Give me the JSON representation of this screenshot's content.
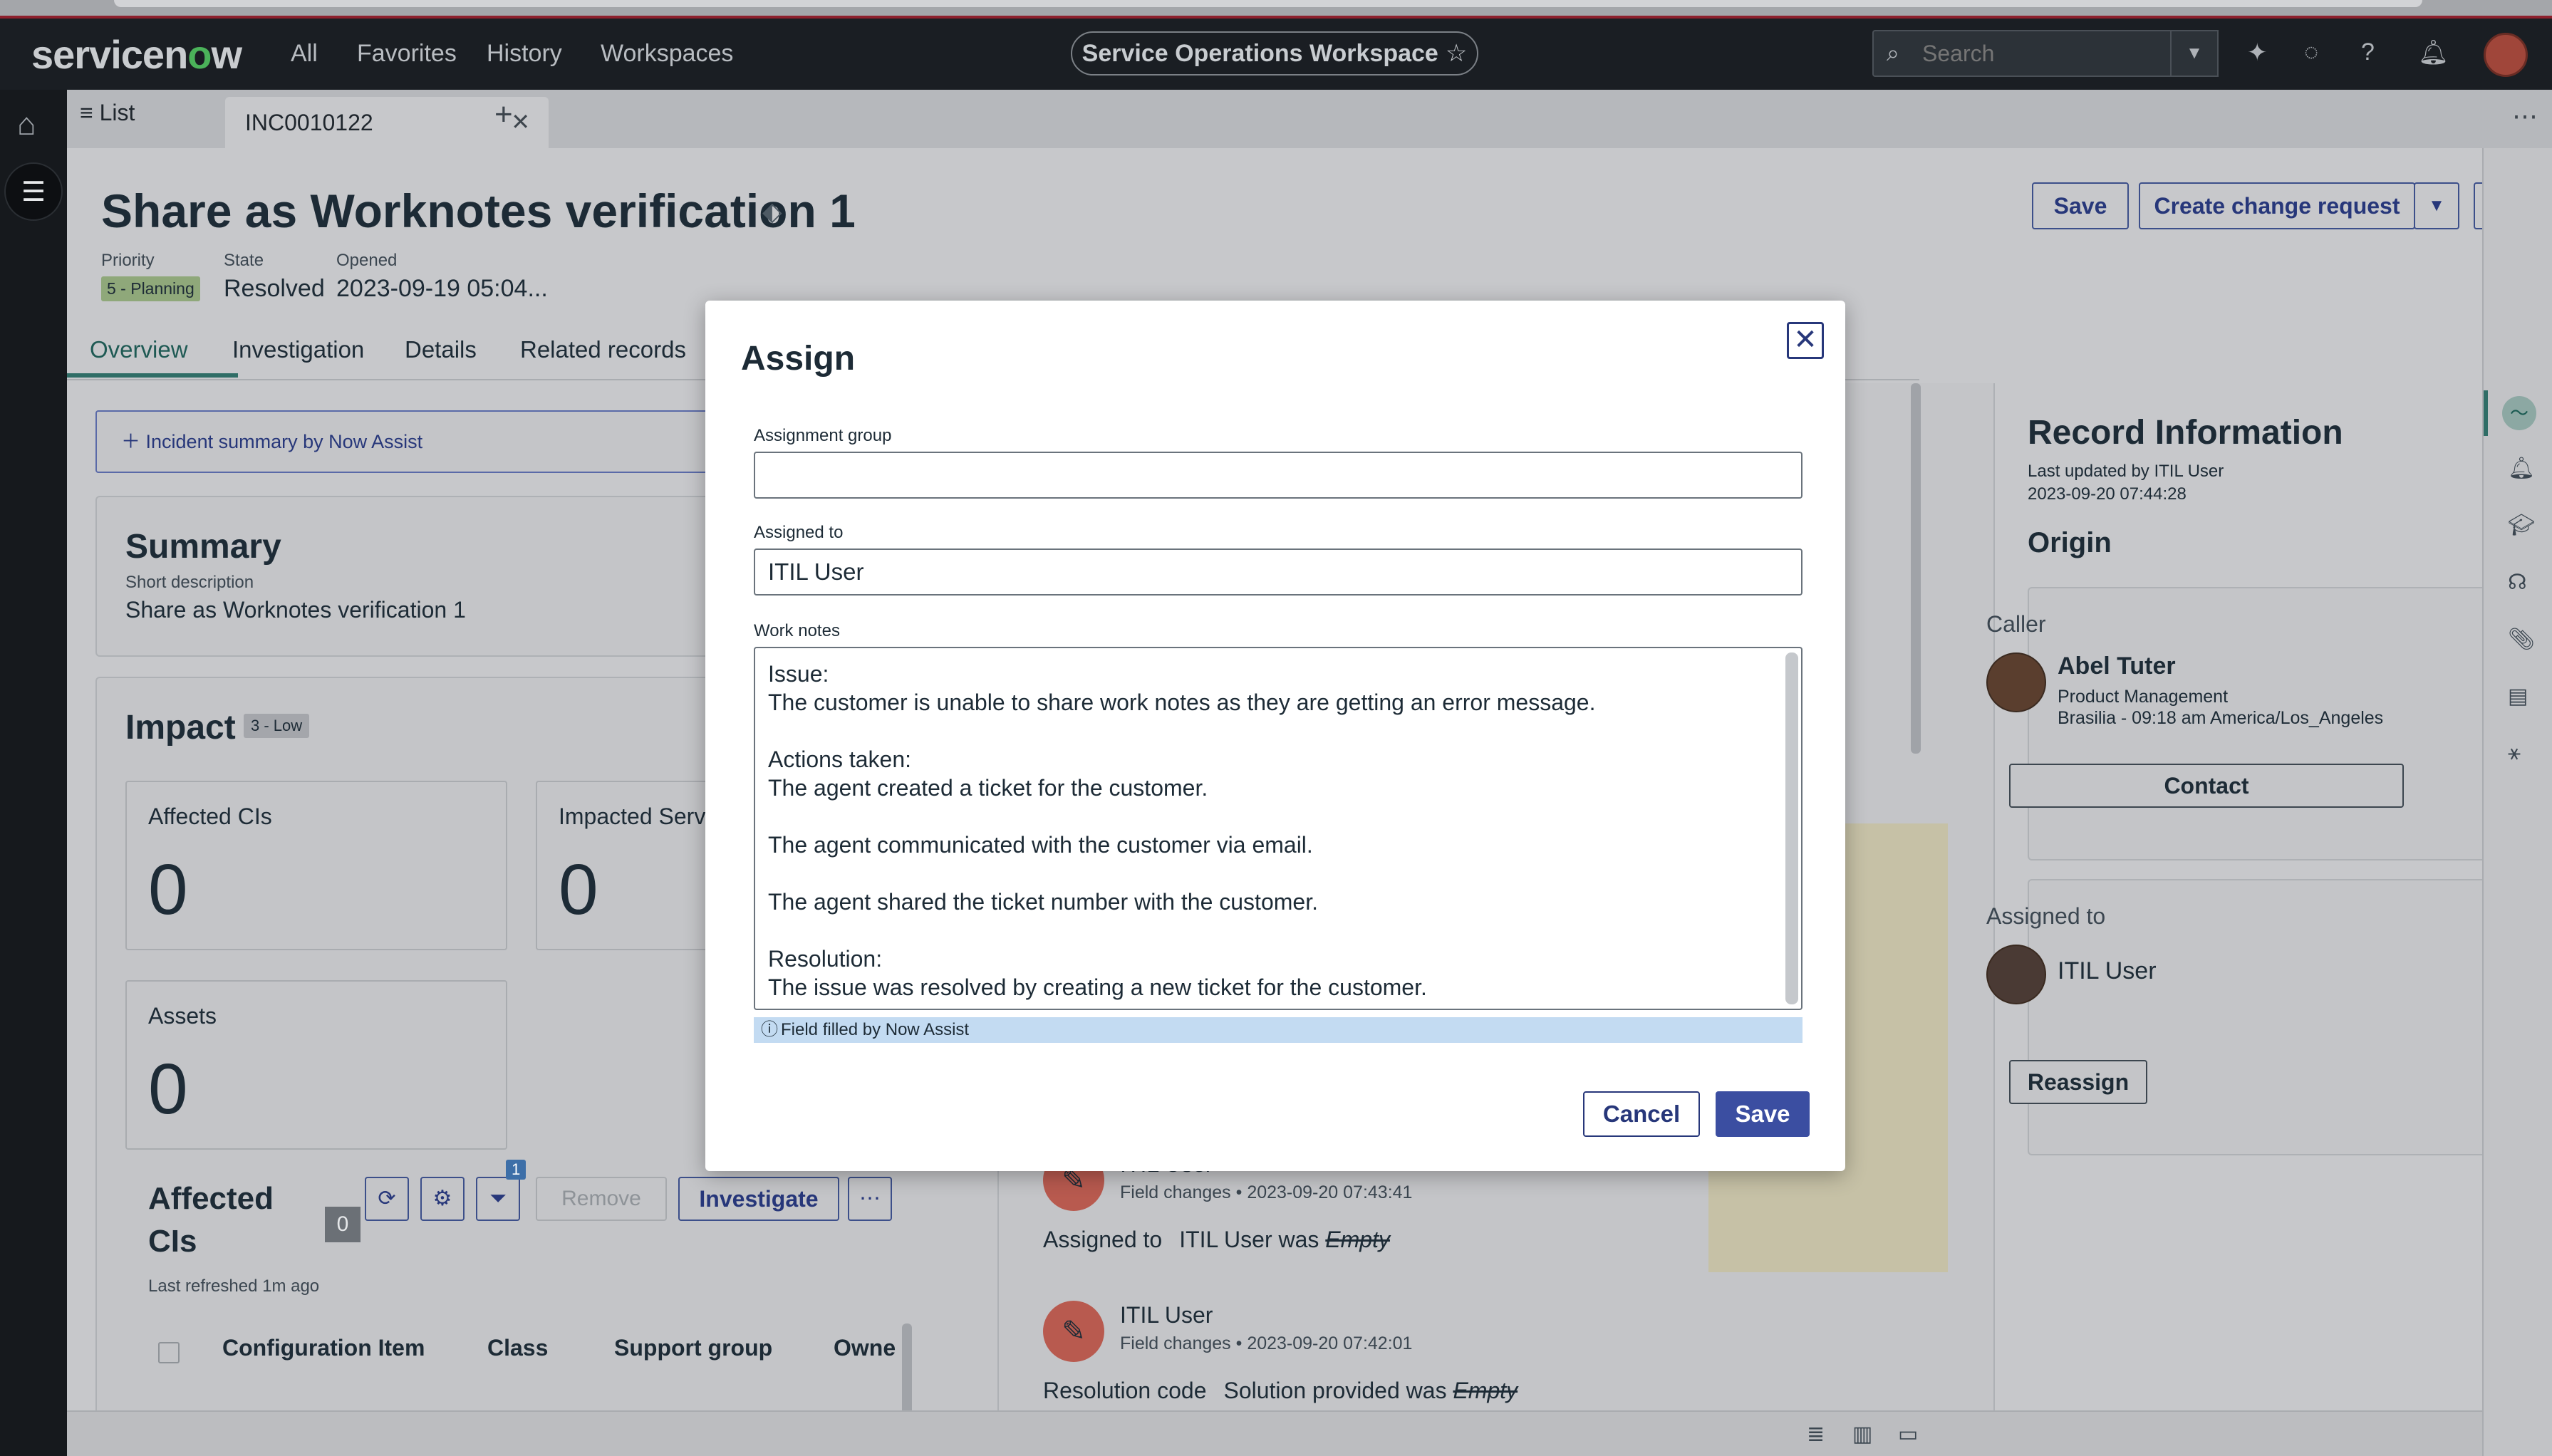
{
  "header": {
    "logo": "servicenow",
    "nav": [
      "All",
      "Favorites",
      "History",
      "Workspaces"
    ],
    "workspace": "Service Operations Workspace",
    "search_placeholder": "Search"
  },
  "tabs": {
    "list_label": "List",
    "active_tab": "INC0010122"
  },
  "record": {
    "title": "Share as Worknotes verification 1",
    "priority_label": "Priority",
    "priority_value": "5 - Planning",
    "state_label": "State",
    "state_value": "Resolved",
    "opened_label": "Opened",
    "opened_value": "2023-09-19 05:04...",
    "save_label": "Save",
    "create_change_label": "Create change request"
  },
  "page_tabs": [
    "Overview",
    "Investigation",
    "Details",
    "Related records"
  ],
  "overview": {
    "now_assist_label": "Incident summary by Now Assist",
    "summary_title": "Summary",
    "short_desc_label": "Short description",
    "short_desc_value": "Share as Worknotes verification 1",
    "impact_title": "Impact",
    "impact_badge": "3 - Low",
    "metrics": [
      {
        "label": "Affected CIs",
        "value": "0"
      },
      {
        "label": "Impacted Servi",
        "value": "0"
      },
      {
        "label": "Assets",
        "value": "0"
      }
    ],
    "affected_cis_title_1": "Affected",
    "affected_cis_title_2": "CIs",
    "affected_count": "0",
    "filter_count": "1",
    "remove_label": "Remove",
    "investigate_label": "Investigate",
    "last_refreshed": "Last refreshed 1m ago",
    "columns": [
      "Configuration Item",
      "Class",
      "Support group",
      "Owne"
    ]
  },
  "activity": [
    {
      "name": "ITIL User",
      "meta": "Field changes",
      "time": "2023-09-20 07:43:41",
      "field": "Assigned to",
      "change": "ITIL User was",
      "old": "Empty"
    },
    {
      "name": "ITIL User",
      "meta": "Field changes",
      "time": "2023-09-20 07:42:01",
      "field": "Resolution code",
      "change": "Solution provided was",
      "old": "Empty"
    }
  ],
  "record_info": {
    "title": "Record Information",
    "last_updated": "Last updated by ITIL User",
    "last_updated_time": "2023-09-20 07:44:28",
    "origin_title": "Origin",
    "caller_label": "Caller",
    "caller_name": "Abel Tuter",
    "caller_dept": "Product Management",
    "caller_loc": "Brasilia - 09:18 am America/Los_Angeles",
    "contact_label": "Contact",
    "assigned_label": "Assigned to",
    "assigned_name": "ITIL User",
    "reassign_label": "Reassign"
  },
  "modal": {
    "title": "Assign",
    "assignment_group_label": "Assignment group",
    "assignment_group_value": "",
    "assigned_to_label": "Assigned to",
    "assigned_to_value": "ITIL User",
    "work_notes_label": "Work notes",
    "work_notes_value": "Issue:\nThe customer is unable to share work notes as they are getting an error message.\n\nActions taken:\nThe agent created a ticket for the customer.\n\nThe agent communicated with the customer via email.\n\nThe agent shared the ticket number with the customer.\n\nResolution:\nThe issue was resolved by creating a new ticket for the customer.",
    "assist_note": "Field filled by Now Assist",
    "cancel_label": "Cancel",
    "save_label": "Save"
  },
  "colors": {
    "primary": "#3b4ea1",
    "header_bg": "#1a1e23",
    "assist_note_bg": "#c3dbf2"
  }
}
